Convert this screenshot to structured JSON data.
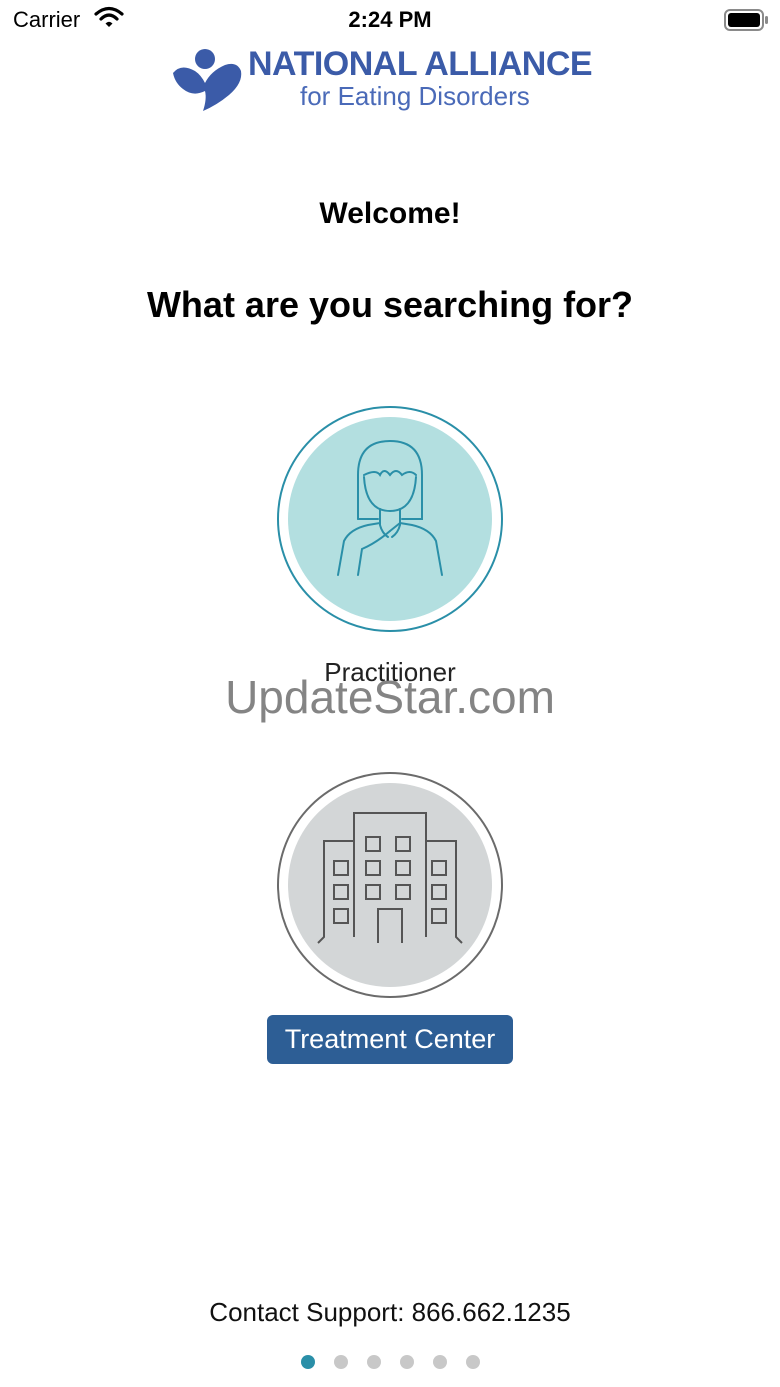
{
  "status_bar": {
    "carrier": "Carrier",
    "time": "2:24 PM",
    "wifi_icon": "wifi-icon",
    "battery_icon": "battery-icon"
  },
  "logo": {
    "line1": "NATIONAL ALLIANCE",
    "line2": "for Eating Disorders",
    "brand_color": "#3b5ba8"
  },
  "welcome": "Welcome!",
  "question": "What are you searching for?",
  "options": [
    {
      "label": "Practitioner",
      "icon": "practitioner-icon",
      "circle_color": "#b3dfe0",
      "ring_color": "#2a8fa8"
    },
    {
      "label": "Treatment Center",
      "icon": "building-icon",
      "circle_color": "#d3d6d7",
      "ring_color": "#6b6b6b",
      "selected": true
    }
  ],
  "watermark": "UpdateStar.com",
  "contact": "Contact Support: 866.662.1235",
  "pager": {
    "total": 6,
    "current": 1,
    "active_color": "#2a8fa8"
  }
}
